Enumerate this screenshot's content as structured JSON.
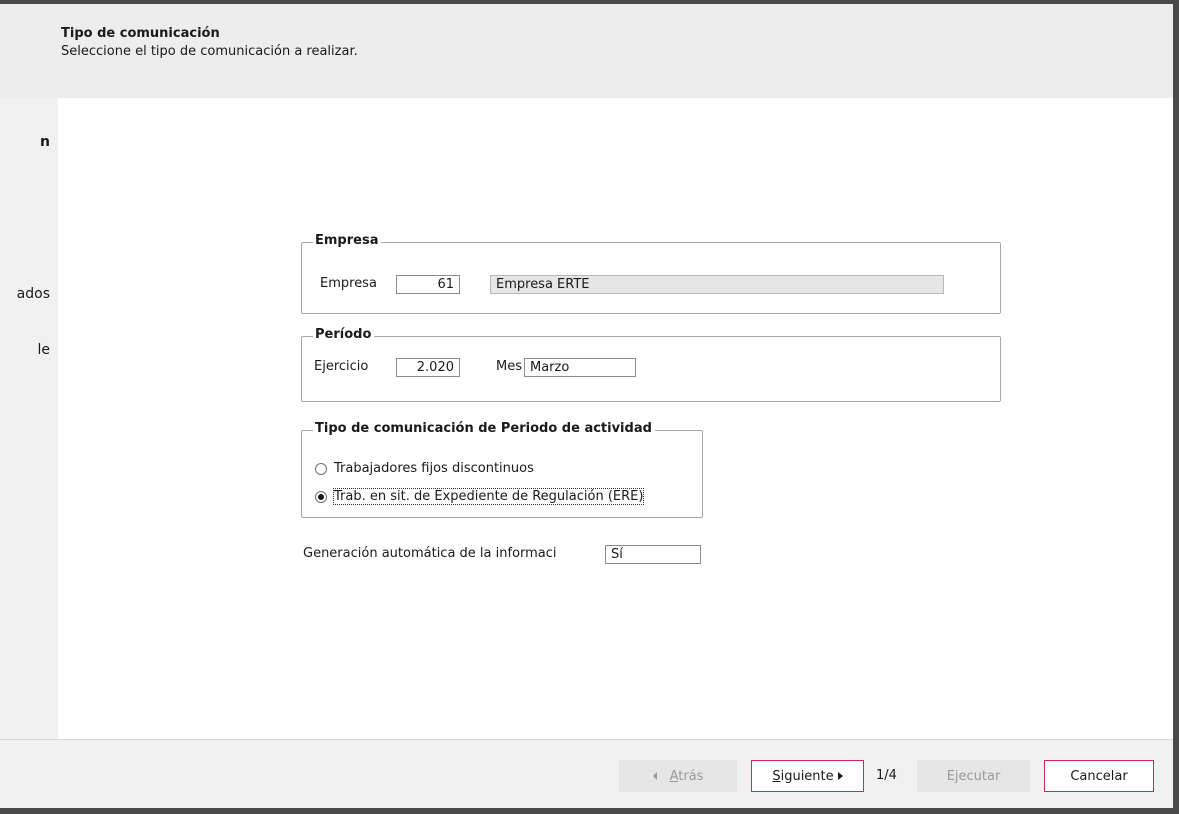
{
  "header": {
    "title": "Tipo de comunicación",
    "subtitle": "Seleccione el tipo de comunicación a realizar."
  },
  "left_pane": {
    "items": [
      "n",
      "ados",
      "le"
    ]
  },
  "empresa_group": {
    "legend": "Empresa",
    "label": "Empresa",
    "code": "61",
    "name": "Empresa ERTE"
  },
  "periodo_group": {
    "legend": "Período",
    "ejercicio_label": "Ejercicio",
    "ejercicio_value": "2.020",
    "mes_label": "Mes",
    "mes_value": "Marzo"
  },
  "tipo_group": {
    "legend": "Tipo de comunicación de Periodo de actividad",
    "options": [
      {
        "label": "Trabajadores fijos discontinuos",
        "selected": false
      },
      {
        "label": "Trab. en sit. de Expediente de Regulación (ERE)",
        "selected": true
      }
    ]
  },
  "generacion": {
    "label": "Generación automática de la informaci",
    "value": "Sí"
  },
  "footer": {
    "back_label_accel": "A",
    "back_label_rest": "trás",
    "next_label_accel": "S",
    "next_label_rest": "iguiente",
    "page_indicator": "1/4",
    "execute_label": "Ejecutar",
    "cancel_label": "Cancelar"
  },
  "colors": {
    "accent": "#d0245a",
    "window_frame": "#4a4a4a"
  }
}
